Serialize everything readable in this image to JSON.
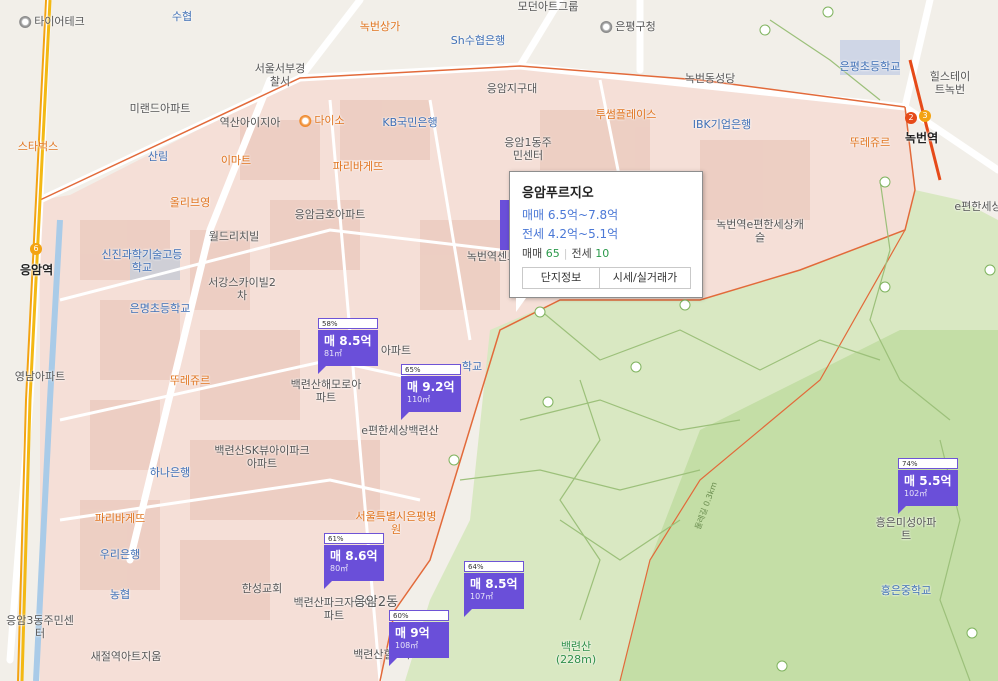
{
  "popup": {
    "title": "응암푸르지오",
    "sale_range": "매매 6.5억~7.8억",
    "jeonse_range": "전세 4.2억~5.1억",
    "sale_count_label": "매매",
    "sale_count": "65",
    "jeonse_count_label": "전세",
    "jeonse_count": "10",
    "tab_info": "단지정보",
    "tab_price": "시세/실거래가"
  },
  "markers": [
    {
      "pct": "58%",
      "price": "매 8.5억",
      "area": "81㎡"
    },
    {
      "pct": "65%",
      "price": "매 9.2억",
      "area": "110㎡"
    },
    {
      "pct": "61%",
      "price": "매 8.6억",
      "area": "80㎡"
    },
    {
      "pct": "64%",
      "price": "매 8.5억",
      "area": "107㎡"
    },
    {
      "pct": "60%",
      "price": "매 9억",
      "area": "108㎡"
    },
    {
      "pct": "74%",
      "price": "매 5.5억",
      "area": "102㎡"
    }
  ],
  "stations": {
    "eungam": "응암역",
    "nokbeon": "녹번역"
  },
  "pois": [
    "타이어테크",
    "수협",
    "녹번상가",
    "모던아트그룹",
    "은평구청",
    "Sh수협은행",
    "서울서부경찰서",
    "응암지구대",
    "녹번동성당",
    "은평초등학교",
    "힐스테이트녹번",
    "미랜드아파트",
    "역산아이지아",
    "다이소",
    "KB국민은행",
    "투썸플레이스",
    "IBK기업은행",
    "스타벅스",
    "산림",
    "이마트",
    "파리바게뜨",
    "응암1동주민센터",
    "뚜레쥬르",
    "올리브영",
    "응암금호아파트",
    "녹번역e편한세상캐슬",
    "월드리치빌",
    "신진과학기술고등학교",
    "서강스카이빌2차",
    "녹번역센트",
    "은명초등학교",
    "영남아파트",
    "뚜레쥬르",
    "백련산해모로아파트",
    "아파트",
    "학교",
    "e편한세상백련산",
    "백련산SK뷰아이파크아파트",
    "하나은행",
    "파리바게뜨",
    "서울특별시은평병원",
    "우리은행",
    "농협",
    "한성교회",
    "백련산파크자이아파트",
    "응암2동",
    "응암3동주민센터",
    "새절역아트지움",
    "백련산힐2차",
    "흥은미성아파트",
    "홍은중학교",
    "백련산(228m)",
    "e편한세상",
    "둘레길 0.3km"
  ],
  "colors": {
    "marker": "#6a4fd9",
    "price_text": "#4b78d6",
    "count_text": "#2b9a4b"
  }
}
